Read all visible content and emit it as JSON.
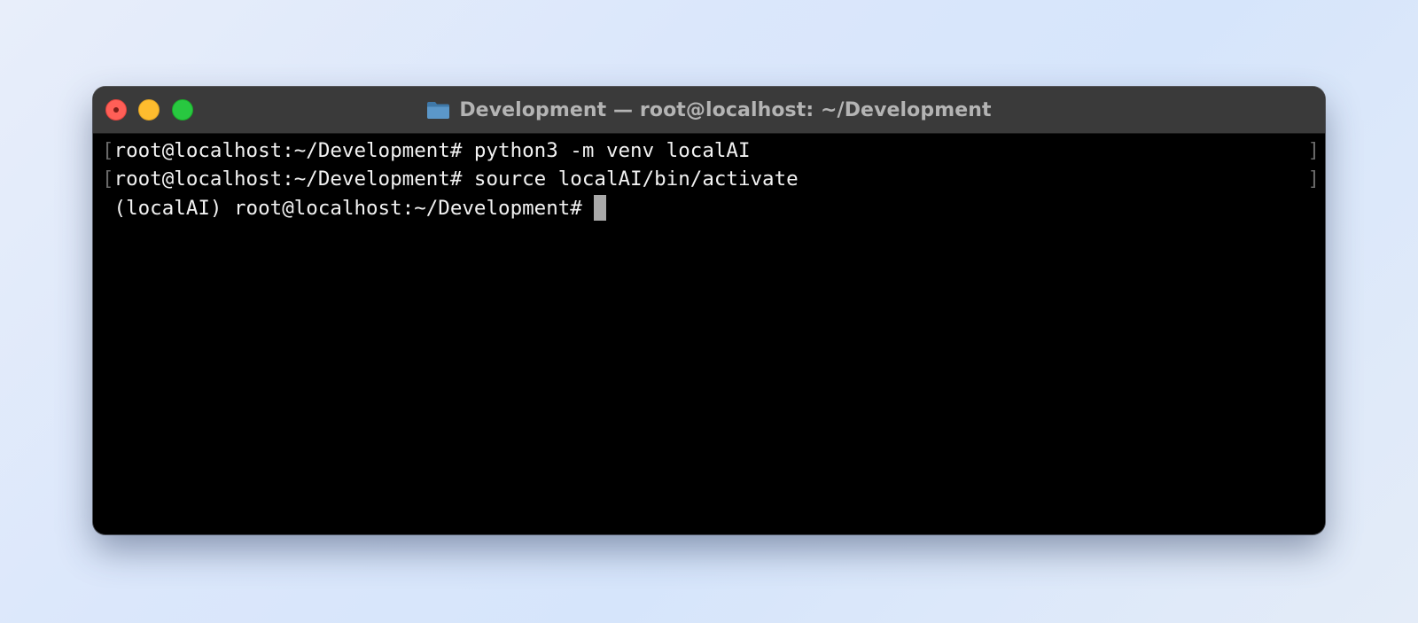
{
  "window": {
    "title": "Development — root@localhost: ~/Development",
    "title_icon": "folder-icon",
    "controls": [
      "close",
      "minimize",
      "zoom"
    ]
  },
  "terminal": {
    "lines": [
      {
        "prompt": "root@localhost:~/Development#",
        "command": " python3 -m venv localAI"
      },
      {
        "prompt": "root@localhost:~/Development#",
        "command": " source localAI/bin/activate"
      },
      {
        "prompt": "(localAI) root@localhost:~/Development#",
        "command": " "
      }
    ],
    "cursor": "block"
  },
  "colors": {
    "close": "#ff5f57",
    "minimize": "#febc2e",
    "zoom": "#28c840",
    "terminal_background": "#000000",
    "terminal_text": "#f2f2f2",
    "titlebar": "#3a3a3a"
  }
}
